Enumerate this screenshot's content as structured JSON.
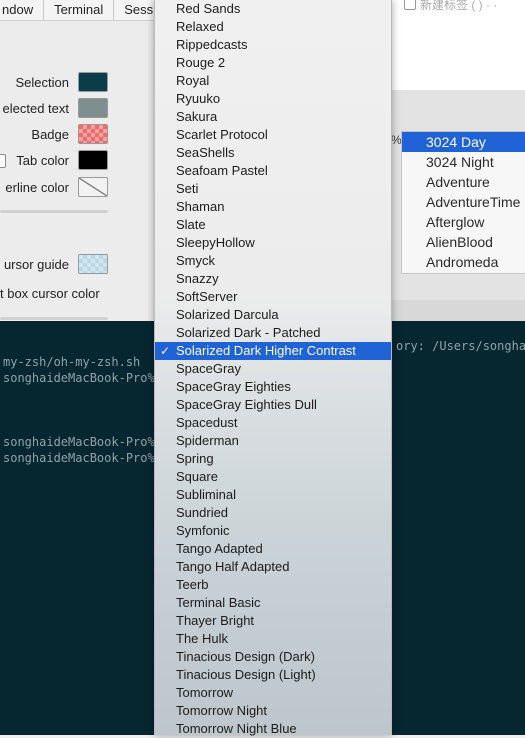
{
  "menubar": {
    "items": [
      "ndow",
      "Terminal",
      "Sess"
    ]
  },
  "prefs": {
    "rows": [
      {
        "label": "Selection",
        "color": "#0b3c4a"
      },
      {
        "label": "elected text",
        "color": "#7f8e8e"
      },
      {
        "label": "Badge",
        "color": "#ef6a6a"
      },
      {
        "label": "Tab color",
        "color": "#000000"
      },
      {
        "label": "erline color",
        "color": "#f2f2f2"
      }
    ],
    "cursor_guide_label": "ursor guide",
    "cursor_guide_color": "#cfe6ef",
    "text_box_cursor_label": "t box cursor color"
  },
  "background_window": {
    "title": "新建标签 (   )  ·  ·",
    "percent_label": "%"
  },
  "secondary_list": {
    "items": [
      "3024 Day",
      "3024 Night",
      "Adventure",
      "AdventureTime",
      "Afterglow",
      "AlienBlood",
      "Andromeda"
    ],
    "selected_index": 0
  },
  "terminal": {
    "lines": [
      {
        "text": "my-zsh/oh-my-zsh.sh",
        "row": 0
      },
      {
        "text": "songhaideMacBook-Pro%",
        "row": 1
      },
      {
        "text": "songhaideMacBook-Pro%",
        "row": 5
      },
      {
        "text": "songhaideMacBook-Pro%",
        "row": 6
      }
    ],
    "right_text": "ory: /Users/songhai/"
  },
  "theme_menu": {
    "selected": "Solarized Dark Higher Contrast",
    "items": [
      "Red Sands",
      "Relaxed",
      "Rippedcasts",
      "Rouge 2",
      "Royal",
      "Ryuuko",
      "Sakura",
      "Scarlet Protocol",
      "SeaShells",
      "Seafoam Pastel",
      "Seti",
      "Shaman",
      "Slate",
      "SleepyHollow",
      "Smyck",
      "Snazzy",
      "SoftServer",
      "Solarized Darcula",
      "Solarized Dark - Patched",
      "Solarized Dark Higher Contrast",
      "SpaceGray",
      "SpaceGray Eighties",
      "SpaceGray Eighties Dull",
      "Spacedust",
      "Spiderman",
      "Spring",
      "Square",
      "Subliminal",
      "Sundried",
      "Symfonic",
      "Tango Adapted",
      "Tango Half Adapted",
      "Teerb",
      "Terminal Basic",
      "Thayer Bright",
      "The Hulk",
      "Tinacious Design (Dark)",
      "Tinacious Design (Light)",
      "Tomorrow",
      "Tomorrow Night",
      "Tomorrow Night Blue"
    ],
    "checkmark": "✓"
  }
}
